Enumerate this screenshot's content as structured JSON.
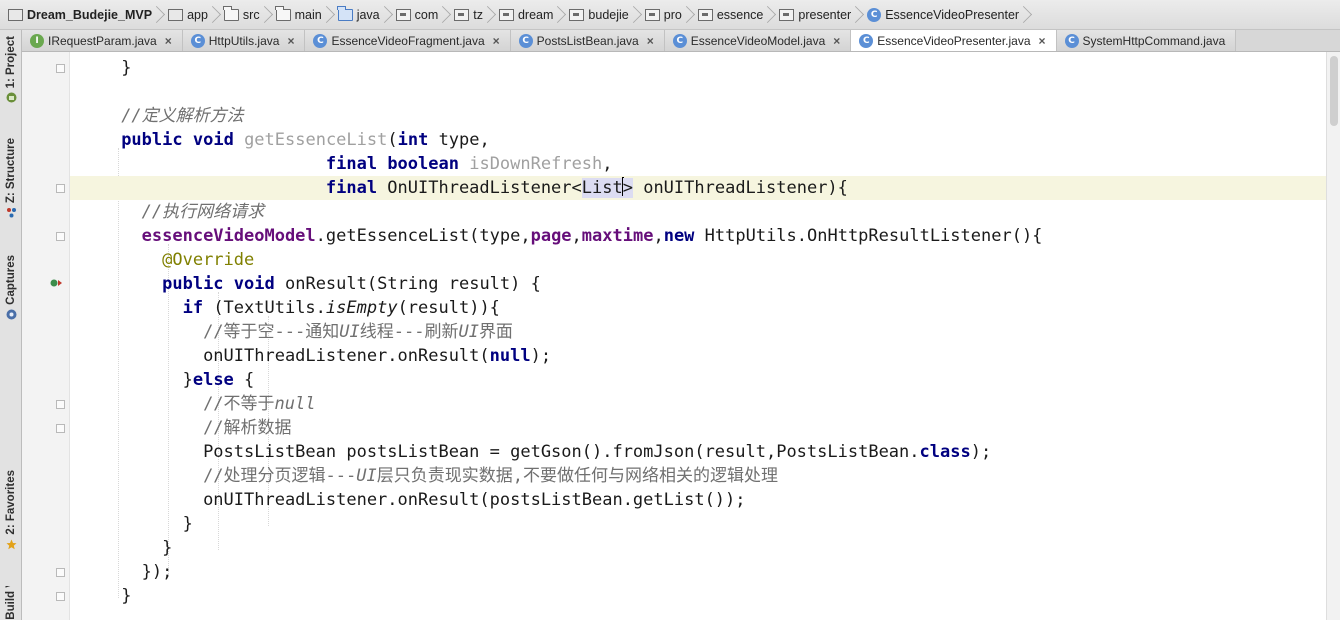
{
  "breadcrumb": [
    {
      "label": "Dream_Budejie_MVP",
      "icon": "module-folder-icon"
    },
    {
      "label": "app",
      "icon": "module-folder-icon"
    },
    {
      "label": "src",
      "icon": "folder-icon"
    },
    {
      "label": "main",
      "icon": "folder-icon"
    },
    {
      "label": "java",
      "icon": "source-folder-icon"
    },
    {
      "label": "com",
      "icon": "package-icon"
    },
    {
      "label": "tz",
      "icon": "package-icon"
    },
    {
      "label": "dream",
      "icon": "package-icon"
    },
    {
      "label": "budejie",
      "icon": "package-icon"
    },
    {
      "label": "pro",
      "icon": "package-icon"
    },
    {
      "label": "essence",
      "icon": "package-icon"
    },
    {
      "label": "presenter",
      "icon": "package-icon"
    },
    {
      "label": "EssenceVideoPresenter",
      "icon": "class-icon"
    }
  ],
  "tabs": [
    {
      "label": "IRequestParam.java",
      "badge": "I",
      "close": "×"
    },
    {
      "label": "HttpUtils.java",
      "badge": "C",
      "close": "×"
    },
    {
      "label": "EssenceVideoFragment.java",
      "badge": "C",
      "close": "×"
    },
    {
      "label": "PostsListBean.java",
      "badge": "C",
      "close": "×"
    },
    {
      "label": "EssenceVideoModel.java",
      "badge": "C",
      "close": "×"
    },
    {
      "label": "EssenceVideoPresenter.java",
      "badge": "C",
      "close": "×",
      "active": true
    },
    {
      "label": "SystemHttpCommand.java",
      "badge": "C",
      "close": ""
    }
  ],
  "toolwindows": {
    "project": "1: Project",
    "structure": "Z: Structure",
    "captures": "Captures",
    "favorites": "2: Favorites",
    "variants": "Build Variants"
  },
  "code": {
    "l1_brace": "}",
    "l3_comment": "//定义解析方法",
    "l4_public": "public",
    "l4_void": "void",
    "l4_method": "getEssenceList",
    "l4_paren": "(",
    "l4_int": "int",
    "l4_param": " type,",
    "l5_final": "final",
    "l5_boolean": "boolean",
    "l5_param": "isDownRefresh",
    "l5_comma": ",",
    "l6_final": "final",
    "l6_type": " OnUIThreadListener<",
    "l6_generic": "List",
    "l6_close": ">",
    "l6_rest": " onUIThreadListener){",
    "l7_comment": "//执行网络请求",
    "l8_field": "essenceVideoModel",
    "l8_call": ".getEssenceList(type,",
    "l8_page": "page",
    "l8_comma": ",",
    "l8_maxtime": "maxtime",
    "l8_comma2": ",",
    "l8_new": "new",
    "l8_rest": " HttpUtils.OnHttpResultListener(){",
    "l9_annotation": "@Override",
    "l10_public": "public",
    "l10_void": "void",
    "l10_rest": " onResult(String result) {",
    "l11_if": "if",
    "l11_pre": " (TextUtils.",
    "l11_isempty": "isEmpty",
    "l11_rest": "(result)){",
    "l12_comment_a": "//等于空---通知",
    "l12_comment_ui1": "UI",
    "l12_comment_b": "线程---刷新",
    "l12_comment_ui2": "UI",
    "l12_comment_c": "界面",
    "l13_pre": "onUIThreadListener.onResult(",
    "l13_null": "null",
    "l13_rest": ");",
    "l14_brace": "}",
    "l14_else": "else",
    "l14_rest": " {",
    "l15_comment_a": "//不等于",
    "l15_comment_null": "null",
    "l16_comment": "//解析数据",
    "l17_pre": "PostsListBean postsListBean = getGson().fromJson(result,PostsListBean.",
    "l17_class": "class",
    "l17_rest": ");",
    "l18_comment_a": "//处理分页逻辑---",
    "l18_comment_ui": "UI",
    "l18_comment_b": "层只负责现实数据,不要做任何与网络相关的逻辑处理",
    "l19": "onUIThreadListener.onResult(postsListBean.getList());",
    "l20_brace": "}",
    "l21_brace": "}",
    "l22_close": "});",
    "l23_brace": "}"
  },
  "colors": {
    "keyword": "#000080",
    "field": "#660e7a",
    "comment": "#707070",
    "annotation": "#808000",
    "current_line": "#f6f5df"
  }
}
